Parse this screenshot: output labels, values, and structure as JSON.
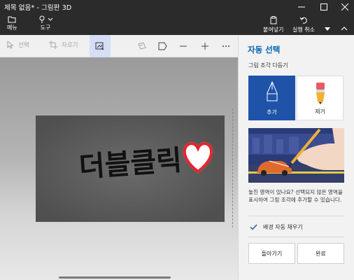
{
  "window": {
    "title": "제목 없음* - 그림판 3D"
  },
  "ribbon": {
    "menu_label": "메뉴",
    "tools_label": "도구",
    "paste_label": "붙여넣기",
    "undo_label": "실행 취소"
  },
  "canvas_toolbar": {
    "select_label": "선택",
    "crop_label": "자르기"
  },
  "canvas": {
    "drawing_text": "더블클릭",
    "heart_color": "#e8222b",
    "text_color": "#111111"
  },
  "panel": {
    "title": "자동 선택",
    "subtitle": "그림 조각 다듬기",
    "add_label": "추가",
    "remove_label": "제거",
    "description": "놓친 영역이 있나요? 선택되지 않은 영역을 표시하여 그림 조각에 추가할 수 있습니다.",
    "fill_background_label": "배경 자동 채우기",
    "fill_background_checked": true,
    "back_button": "돌아가기",
    "done_button": "완료"
  },
  "colors": {
    "accent": "#1f53a8",
    "title_accent": "#0063b1",
    "chrome": "#2b2b2b"
  }
}
